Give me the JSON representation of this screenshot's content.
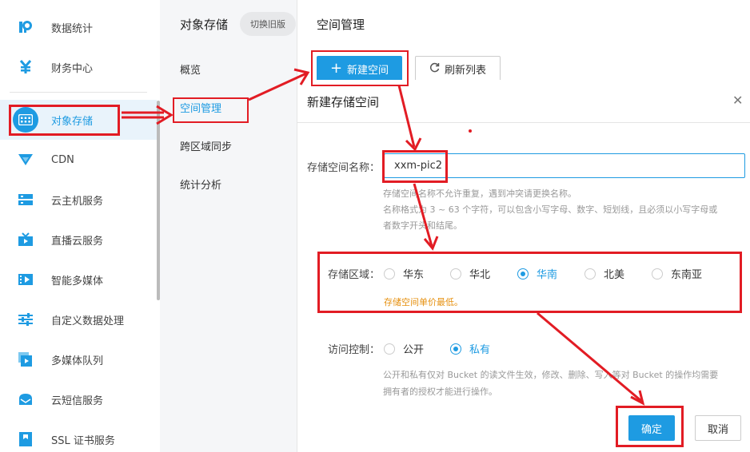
{
  "sidebar": {
    "items": [
      {
        "label": "数据统计",
        "icon": "stats-icon"
      },
      {
        "label": "财务中心",
        "icon": "yen-icon"
      },
      {
        "label": "对象存储",
        "icon": "storage-icon"
      },
      {
        "label": "CDN",
        "icon": "cdn-icon"
      },
      {
        "label": "云主机服务",
        "icon": "server-icon"
      },
      {
        "label": "直播云服务",
        "icon": "live-icon"
      },
      {
        "label": "智能多媒体",
        "icon": "media-icon"
      },
      {
        "label": "自定义数据处理",
        "icon": "sliders-icon"
      },
      {
        "label": "多媒体队列",
        "icon": "queue-icon"
      },
      {
        "label": "云短信服务",
        "icon": "sms-icon"
      },
      {
        "label": "SSL 证书服务",
        "icon": "certificate-icon"
      }
    ],
    "active_index": 2
  },
  "subnav": {
    "title": "对象存储",
    "switch_label": "切换旧版",
    "items": [
      {
        "label": "概览"
      },
      {
        "label": "空间管理"
      },
      {
        "label": "跨区域同步"
      },
      {
        "label": "统计分析"
      }
    ],
    "active_index": 1
  },
  "main": {
    "title": "空间管理",
    "new_bucket_label": "新建空间",
    "refresh_label": "刷新列表"
  },
  "dialog": {
    "title": "新建存储空间",
    "name_label": "存储空间名称：",
    "name_value": "xxm-pic2",
    "name_hint_1": "存储空间名称不允许重复，遇到冲突请更换名称。",
    "name_hint_2": "名称格式为 3 ~ 63 个字符，可以包含小写字母、数字、短划线，且必须以小写字母或",
    "name_hint_3": "者数字开头和结尾。",
    "region_label": "存储区域：",
    "regions": [
      {
        "label": "华东",
        "checked": false
      },
      {
        "label": "华北",
        "checked": false
      },
      {
        "label": "华南",
        "checked": true
      },
      {
        "label": "北美",
        "checked": false
      },
      {
        "label": "东南亚",
        "checked": false
      }
    ],
    "region_note": "存储空间单价最低。",
    "access_label": "访问控制：",
    "access_options": [
      {
        "label": "公开",
        "checked": false
      },
      {
        "label": "私有",
        "checked": true
      }
    ],
    "access_hint_1": "公开和私有仅对 Bucket 的读文件生效，修改、删除、写入等对 Bucket 的操作均需要",
    "access_hint_2": "拥有者的授权才能进行操作。",
    "ok_label": "确定",
    "cancel_label": "取消"
  },
  "colors": {
    "accent": "#1e9be2",
    "annotation_red": "#e21c24",
    "note_orange": "#e6900f"
  }
}
